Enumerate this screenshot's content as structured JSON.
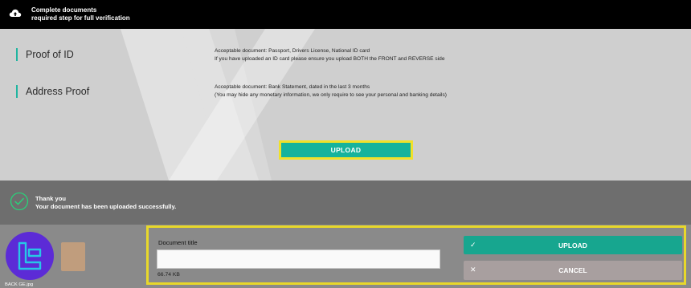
{
  "topbar": {
    "icon": "cloud-upload-icon",
    "line1": "Complete documents",
    "line2": "required step for full verification"
  },
  "sections": {
    "proof_of_id": {
      "title": "Proof of ID",
      "line1": "Acceptable document: Passport, Drivers License, National ID card",
      "line2": "If you have uploaded an ID card please ensure you upload BOTH the FRONT and REVERSE side"
    },
    "address_proof": {
      "title": "Address Proof",
      "line1": "Acceptable document: Bank Statement, dated in the last 3 months",
      "line2": "(You may hide any monetary information, we only require to see your personal and banking details)"
    }
  },
  "main_upload_label": "UPLOAD",
  "notice": {
    "icon": "check-circle-icon",
    "line1": "Thank you",
    "line2": "Your document has been uploaded successfully."
  },
  "file": {
    "logo": "broker-logo",
    "name": "BACK GE.jpg",
    "size": "66.74 KB"
  },
  "form": {
    "doc_title_label": "Document title",
    "doc_title_value": "",
    "doc_title_placeholder": "",
    "upload_label": "UPLOAD",
    "upload_icon": "check-icon",
    "cancel_label": "CANCEL",
    "cancel_icon": "close-icon"
  },
  "colors": {
    "accent": "#16b39c",
    "highlight": "#f0e12a",
    "logo": "#5c2bd6"
  }
}
